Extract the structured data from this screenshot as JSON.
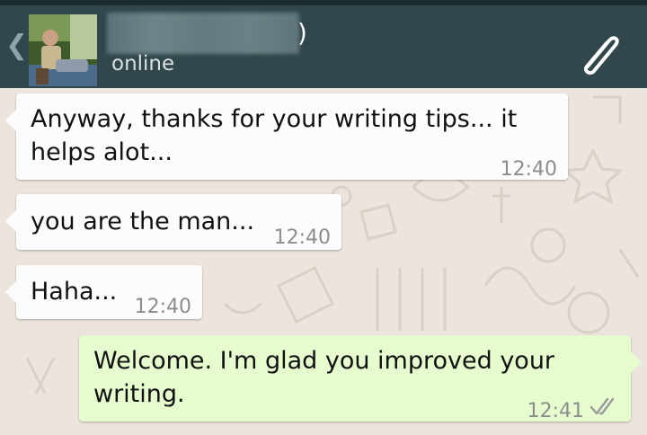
{
  "header": {
    "back_icon": "chevron-left-icon",
    "contact_name_suffix": ")",
    "status": "online",
    "attach_icon": "paperclip-icon"
  },
  "messages": [
    {
      "direction": "incoming",
      "lines": [
        "Anyway, thanks for your writing tips... it",
        "helps alot..."
      ],
      "time": "12:40"
    },
    {
      "direction": "incoming",
      "lines": [
        "you are the man..."
      ],
      "time": "12:40"
    },
    {
      "direction": "incoming",
      "lines": [
        "Haha..."
      ],
      "time": "12:40"
    },
    {
      "direction": "outgoing",
      "lines": [
        "Welcome. I'm glad you improved your",
        "writing."
      ],
      "time": "12:41",
      "status_icon": "double-check-icon"
    }
  ],
  "colors": {
    "header": "#31474c",
    "chat_background": "#ece5dd",
    "incoming_bubble": "#fcfcfc",
    "outgoing_bubble": "#e6fccf"
  }
}
